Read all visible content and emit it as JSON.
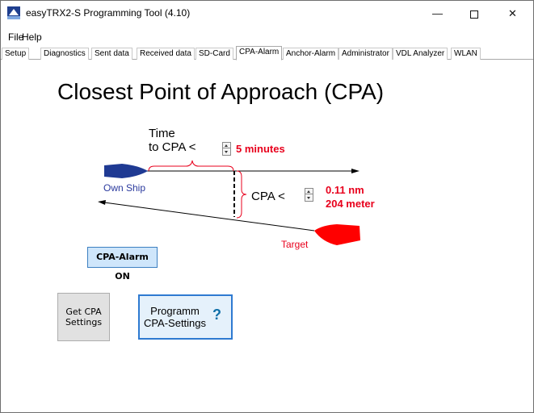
{
  "window": {
    "title": "easyTRX2-S Programming Tool  (4.10)",
    "minimize_glyph": "—",
    "close_glyph": "✕"
  },
  "menu": {
    "file": "File",
    "help": "Help"
  },
  "tabs": [
    {
      "label": "Setup"
    },
    {
      "label": "Diagnostics"
    },
    {
      "label": "Sent data"
    },
    {
      "label": "Received data"
    },
    {
      "label": "SD-Card"
    },
    {
      "label": "CPA-Alarm",
      "active": true
    },
    {
      "label": "Anchor-Alarm"
    },
    {
      "label": "Administrator"
    },
    {
      "label": "VDL Analyzer"
    },
    {
      "label": "WLAN"
    }
  ],
  "cpa": {
    "title": "Closest Point of Approach (CPA)",
    "time_label_line1": "Time",
    "time_label_line2": "to CPA  <",
    "time_value": "5 minutes",
    "cpa_label": "CPA  <",
    "distance_nm": "0.11 nm",
    "distance_m": "204 meter",
    "own_ship_label": "Own Ship",
    "target_label": "Target",
    "alarm_button": "CPA-Alarm ON",
    "get_button_line1": "Get CPA",
    "get_button_line2": "Settings",
    "program_button_line1": "Programm",
    "program_button_line2": "CPA-Settings",
    "help_glyph": "?"
  },
  "colors": {
    "own_ship": "#1f3a93",
    "target": "#e8001c",
    "accent_button": "#2e7ad1"
  },
  "icons": {
    "app": "easytrx-app-icon",
    "help": "help-question-icon"
  }
}
